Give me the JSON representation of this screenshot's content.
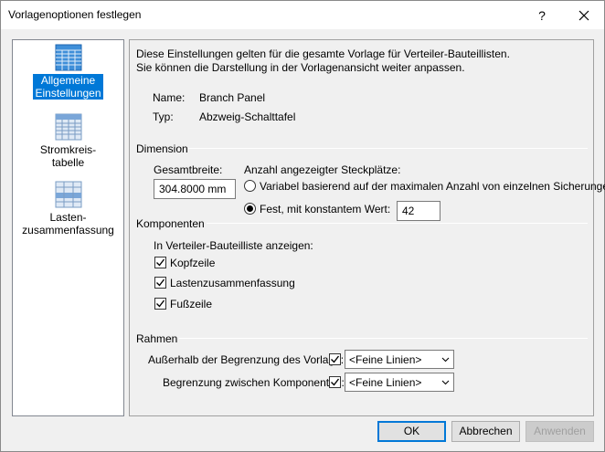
{
  "window": {
    "title": "Vorlagenoptionen festlegen",
    "help_label": "?",
    "close_label": "✕"
  },
  "sidebar": {
    "items": [
      {
        "label_line1": "Allgemeine",
        "label_line2": "Einstellungen",
        "icon": "grid-table-icon",
        "active": true
      },
      {
        "label_line1": "Stromkreis-",
        "label_line2": "tabelle",
        "icon": "circuit-table-icon",
        "active": false
      },
      {
        "label_line1": "Lasten-",
        "label_line2": "zusammenfassung",
        "icon": "load-summary-icon",
        "active": false
      }
    ]
  },
  "main": {
    "description_line1": "Diese Einstellungen gelten für die gesamte Vorlage für Verteiler-Bauteillisten.",
    "description_line2": "Sie können die Darstellung in der Vorlagenansicht weiter anpassen.",
    "name_label": "Name:",
    "name_value": "Branch Panel",
    "type_label": "Typ:",
    "type_value": "Abzweig-Schalttafel",
    "dimension": {
      "title": "Dimension",
      "total_width_label": "Gesamtbreite:",
      "total_width_value": "304.8000 mm",
      "slots_label": "Anzahl angezeigter Steckplätze:",
      "variable_option": "Variabel basierend auf der maximalen Anzahl von einzelnen Sicherungen",
      "fixed_option": "Fest, mit konstantem Wert:",
      "fixed_value": "42",
      "selected": "fixed"
    },
    "components": {
      "title": "Komponenten",
      "show_label": "In Verteiler-Bauteilliste anzeigen:",
      "header_row": {
        "label": "Kopfzeile",
        "checked": true
      },
      "load_summary": {
        "label": "Lastenzusammenfassung",
        "checked": true
      },
      "footer": {
        "label": "Fußzeile",
        "checked": true
      }
    },
    "frame": {
      "title": "Rahmen",
      "outside_label": "Außerhalb der Begrenzung des Vorlage:",
      "outside_checked": true,
      "outside_value": "<Feine Linien>",
      "between_label": "Begrenzung zwischen Komponenten:",
      "between_checked": true,
      "between_value": "<Feine Linien>"
    }
  },
  "footer": {
    "ok_label": "OK",
    "cancel_label": "Abbrechen",
    "apply_label": "Anwenden"
  },
  "colors": {
    "accent": "#0078d7",
    "sidebar_icon": "#3f8fd9"
  }
}
